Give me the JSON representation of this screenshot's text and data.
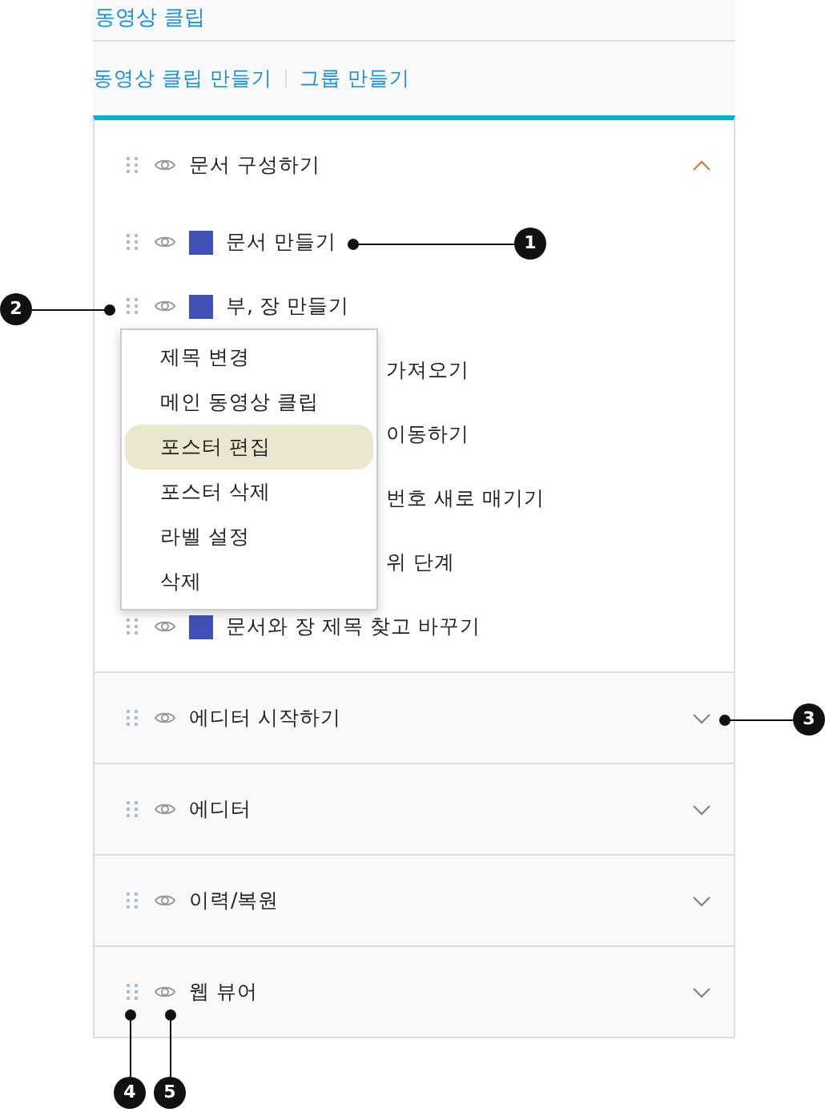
{
  "header": {
    "title": "동영상 클립"
  },
  "actions": [
    {
      "label": "동영상 클립 만들기"
    },
    {
      "label": "그룹 만들기"
    }
  ],
  "groups": [
    {
      "title": "문서 구성하기",
      "expanded": true,
      "items": [
        {
          "kind": "item",
          "title": "문서 만들기",
          "color": "#3f51b5"
        },
        {
          "kind": "item",
          "title": "부, 장 만들기",
          "color": "#3f51b5"
        },
        {
          "kind": "covered",
          "title": "가져오기"
        },
        {
          "kind": "covered",
          "title": "이동하기"
        },
        {
          "kind": "covered",
          "title": "번호 새로 매기기"
        },
        {
          "kind": "covered",
          "title": "위 단계"
        },
        {
          "kind": "item",
          "title": "문서와 장 제목 찾고 바꾸기",
          "color": "#3f51b5"
        }
      ]
    },
    {
      "title": "에디터 시작하기",
      "expanded": false
    },
    {
      "title": "에디터",
      "expanded": false
    },
    {
      "title": "이력/복원",
      "expanded": false
    },
    {
      "title": "웹 뷰어",
      "expanded": false
    }
  ],
  "context_menu": {
    "items": [
      {
        "label": "제목 변경",
        "selected": false
      },
      {
        "label": "메인 동영상 클립",
        "selected": false
      },
      {
        "label": "포스터 편집",
        "selected": true
      },
      {
        "label": "포스터 삭제",
        "selected": false
      },
      {
        "label": "라벨 설정",
        "selected": false
      },
      {
        "label": "삭제",
        "selected": false
      }
    ]
  },
  "callouts": [
    {
      "number": "1"
    },
    {
      "number": "2"
    },
    {
      "number": "3"
    },
    {
      "number": "4"
    },
    {
      "number": "5"
    }
  ]
}
